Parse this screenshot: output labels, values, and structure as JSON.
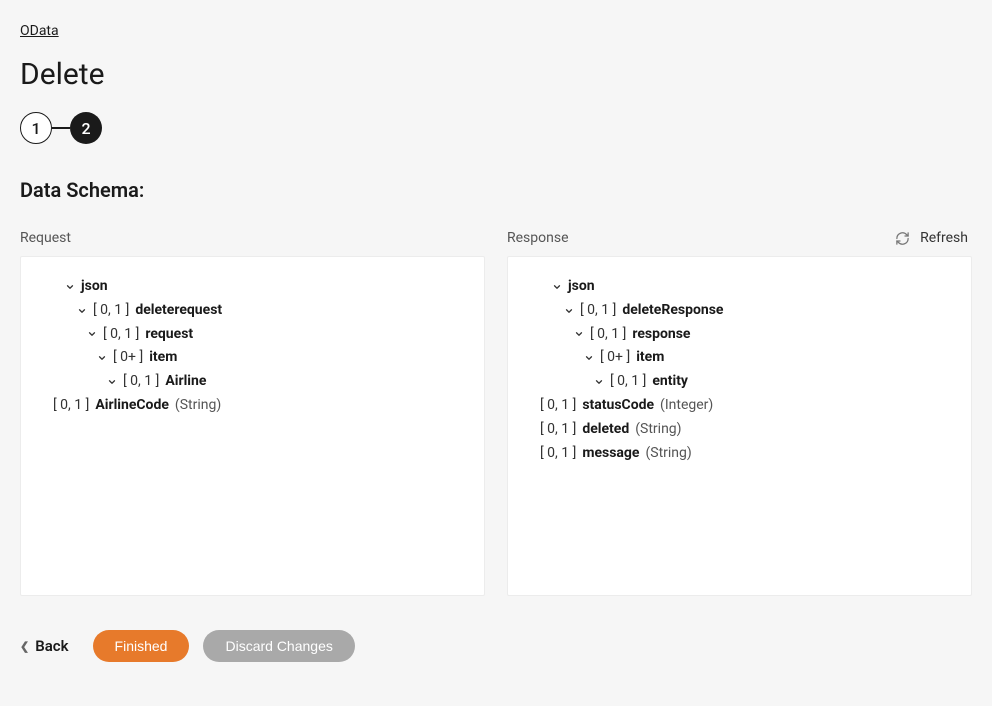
{
  "breadcrumb": "OData",
  "pageTitle": "Delete",
  "stepper": {
    "step1": "1",
    "step2": "2"
  },
  "sectionTitle": "Data Schema:",
  "refreshLabel": "Refresh",
  "columns": {
    "request": {
      "header": "Request",
      "rows": [
        {
          "indent": 0,
          "chev": true,
          "card": "",
          "name": "json",
          "type": ""
        },
        {
          "indent": 1,
          "chev": true,
          "card": "[ 0, 1 ]",
          "name": "deleterequest",
          "type": ""
        },
        {
          "indent": 2,
          "chev": true,
          "card": "[ 0, 1 ]",
          "name": "request",
          "type": ""
        },
        {
          "indent": 3,
          "chev": true,
          "card": "[ 0+ ]",
          "name": "item",
          "type": ""
        },
        {
          "indent": 4,
          "chev": true,
          "card": "[ 0, 1 ]",
          "name": "Airline",
          "type": ""
        },
        {
          "indent": 5,
          "chev": false,
          "card": "[ 0, 1 ]",
          "name": "AirlineCode",
          "type": "(String)"
        }
      ]
    },
    "response": {
      "header": "Response",
      "rows": [
        {
          "indent": 0,
          "chev": true,
          "card": "",
          "name": "json",
          "type": ""
        },
        {
          "indent": 1,
          "chev": true,
          "card": "[ 0, 1 ]",
          "name": "deleteResponse",
          "type": ""
        },
        {
          "indent": 2,
          "chev": true,
          "card": "[ 0, 1 ]",
          "name": "response",
          "type": ""
        },
        {
          "indent": 3,
          "chev": true,
          "card": "[ 0+ ]",
          "name": "item",
          "type": ""
        },
        {
          "indent": 4,
          "chev": true,
          "card": "[ 0, 1 ]",
          "name": "entity",
          "type": ""
        },
        {
          "indent": 5,
          "chev": false,
          "card": "[ 0, 1 ]",
          "name": "statusCode",
          "type": "(Integer)"
        },
        {
          "indent": 5,
          "chev": false,
          "card": "[ 0, 1 ]",
          "name": "deleted",
          "type": "(String)"
        },
        {
          "indent": 5,
          "chev": false,
          "card": "[ 0, 1 ]",
          "name": "message",
          "type": "(String)"
        }
      ]
    }
  },
  "footer": {
    "back": "Back",
    "finished": "Finished",
    "discard": "Discard Changes"
  }
}
